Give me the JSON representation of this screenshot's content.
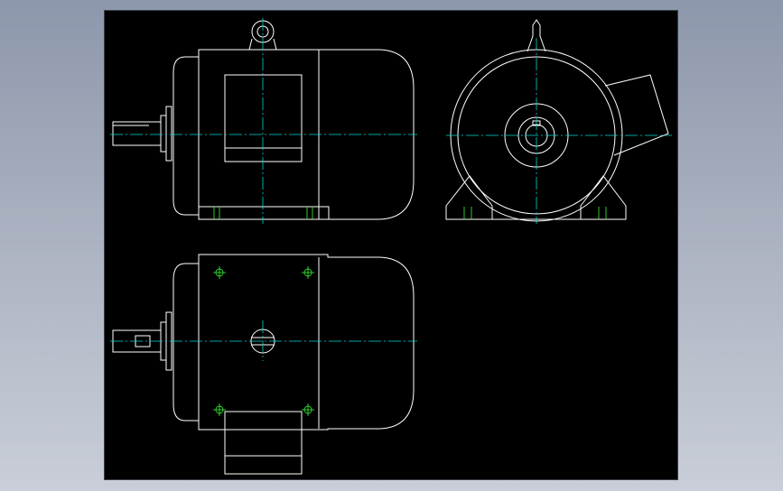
{
  "drawing": {
    "views": [
      "front-view",
      "end-view",
      "top-view"
    ],
    "colors": {
      "background": "#000000",
      "outline": "#ffffff",
      "centerline": "#00d8d8",
      "bolt_marks": "#33dd33",
      "window_gradient_top": "#8d97ab",
      "window_gradient_bottom": "#c9ced8"
    }
  }
}
